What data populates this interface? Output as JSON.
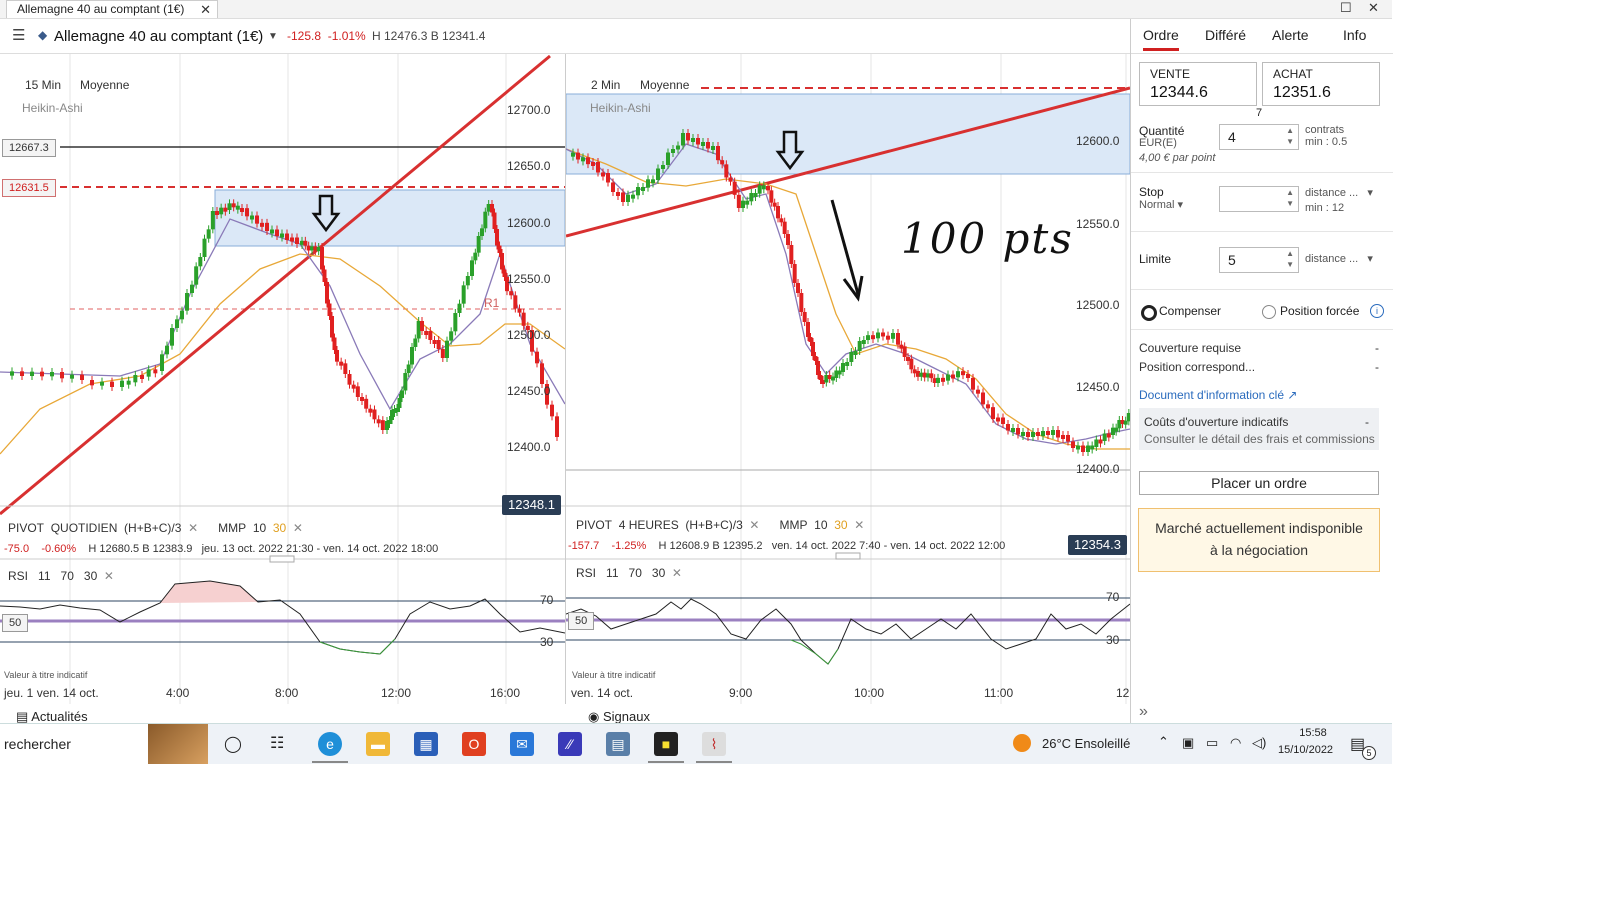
{
  "tab": {
    "title": "Allemagne 40 au comptant (1€)",
    "close": "✕"
  },
  "window": {
    "maximize": "☐",
    "close": "✕"
  },
  "header": {
    "title": "Allemagne 40 au comptant (1€)",
    "change": "-125.8",
    "change_pct": "-1.01%",
    "hl": "H 12476.3 B 12341.4"
  },
  "left_chart": {
    "interval": "15 Min",
    "overlay": "Moyenne",
    "style": "Heikin-Ashi",
    "y_ticks": [
      "12700.0",
      "12650.0",
      "12600.0",
      "12550.0",
      "12500.0",
      "12450.0",
      "12400.0"
    ],
    "level_1": "12667.3",
    "level_2": "12631.5",
    "r1": "R1",
    "current": "12348.1",
    "pivot": {
      "name": "PIVOT",
      "period": "QUOTIDIEN",
      "formula": "(H+B+C)/3",
      "mmp": "MMP",
      "p1": "10",
      "p2": "30"
    },
    "stats": {
      "chg": "-75.0",
      "pct": "-0.60%",
      "hl": "H 12680.5 B 12383.9",
      "range": "jeu. 13 oct. 2022 21:30 - ven. 14 oct. 2022 18:00"
    },
    "rsi": {
      "label": "RSI",
      "p1": "11",
      "p2": "70",
      "p3": "30",
      "mid": "50",
      "hi": "70",
      "lo": "30"
    },
    "note": "Valeur à titre indicatif",
    "x_ticks": [
      "jeu. 1 ven. 14 oct.",
      "4:00",
      "8:00",
      "12:00",
      "16:00"
    ],
    "footer": "Actualités"
  },
  "right_chart": {
    "interval": "2 Min",
    "overlay": "Moyenne",
    "style": "Heikin-Ashi",
    "y_ticks": [
      "12600.0",
      "12550.0",
      "12500.0",
      "12450.0",
      "12400.0"
    ],
    "current": "12354.3",
    "annotation": "100 pts",
    "pivot": {
      "name": "PIVOT",
      "period": "4 HEURES",
      "formula": "(H+B+C)/3",
      "mmp": "MMP",
      "p1": "10",
      "p2": "30"
    },
    "stats": {
      "chg": "-157.7",
      "pct": "-1.25%",
      "hl": "H 12608.9 B 12395.2",
      "range": "ven. 14 oct. 2022 7:40 - ven. 14 oct. 2022 12:00"
    },
    "rsi": {
      "label": "RSI",
      "p1": "11",
      "p2": "70",
      "p3": "30",
      "mid": "50",
      "hi": "70",
      "lo": "30"
    },
    "note": "Valeur à titre indicatif",
    "x_ticks": [
      "ven. 14 oct.",
      "9:00",
      "10:00",
      "11:00",
      "12"
    ],
    "footer": "Signaux"
  },
  "order": {
    "tabs": [
      "Ordre",
      "Différé",
      "Alerte",
      "Info"
    ],
    "sell_label": "VENTE",
    "sell": "12344.6",
    "buy_label": "ACHAT",
    "buy": "12351.6",
    "spread": "7",
    "qty_label": "Quantité",
    "qty_unit": "EUR(E)",
    "qty": "4",
    "qty_right1": "contrats",
    "qty_right2": "min : 0.5",
    "per_point": "4,00 € par point",
    "stop_label": "Stop",
    "stop_type": "Normal",
    "stop_right1": "distance ...",
    "stop_right2": "min : 12",
    "limit_label": "Limite",
    "limit": "5",
    "limit_right": "distance ...",
    "opt1": "Compenser",
    "opt2": "Position forcée",
    "cov_label": "Couverture requise",
    "cov_val": "-",
    "pos_label": "Position correspond...",
    "pos_val": "-",
    "doc_link": "Document d'information clé",
    "costs_label": "Coûts d'ouverture indicatifs",
    "costs_val": "-",
    "costs_sub": "Consulter le détail des frais et commissions",
    "place": "Placer un ordre",
    "warning_1": "Marché actuellement indisponible",
    "warning_2": "à la négociation"
  },
  "taskbar": {
    "search": "rechercher",
    "weather": "26°C Ensoleillé",
    "time": "15:58",
    "date": "15/10/2022",
    "notif": "5"
  }
}
